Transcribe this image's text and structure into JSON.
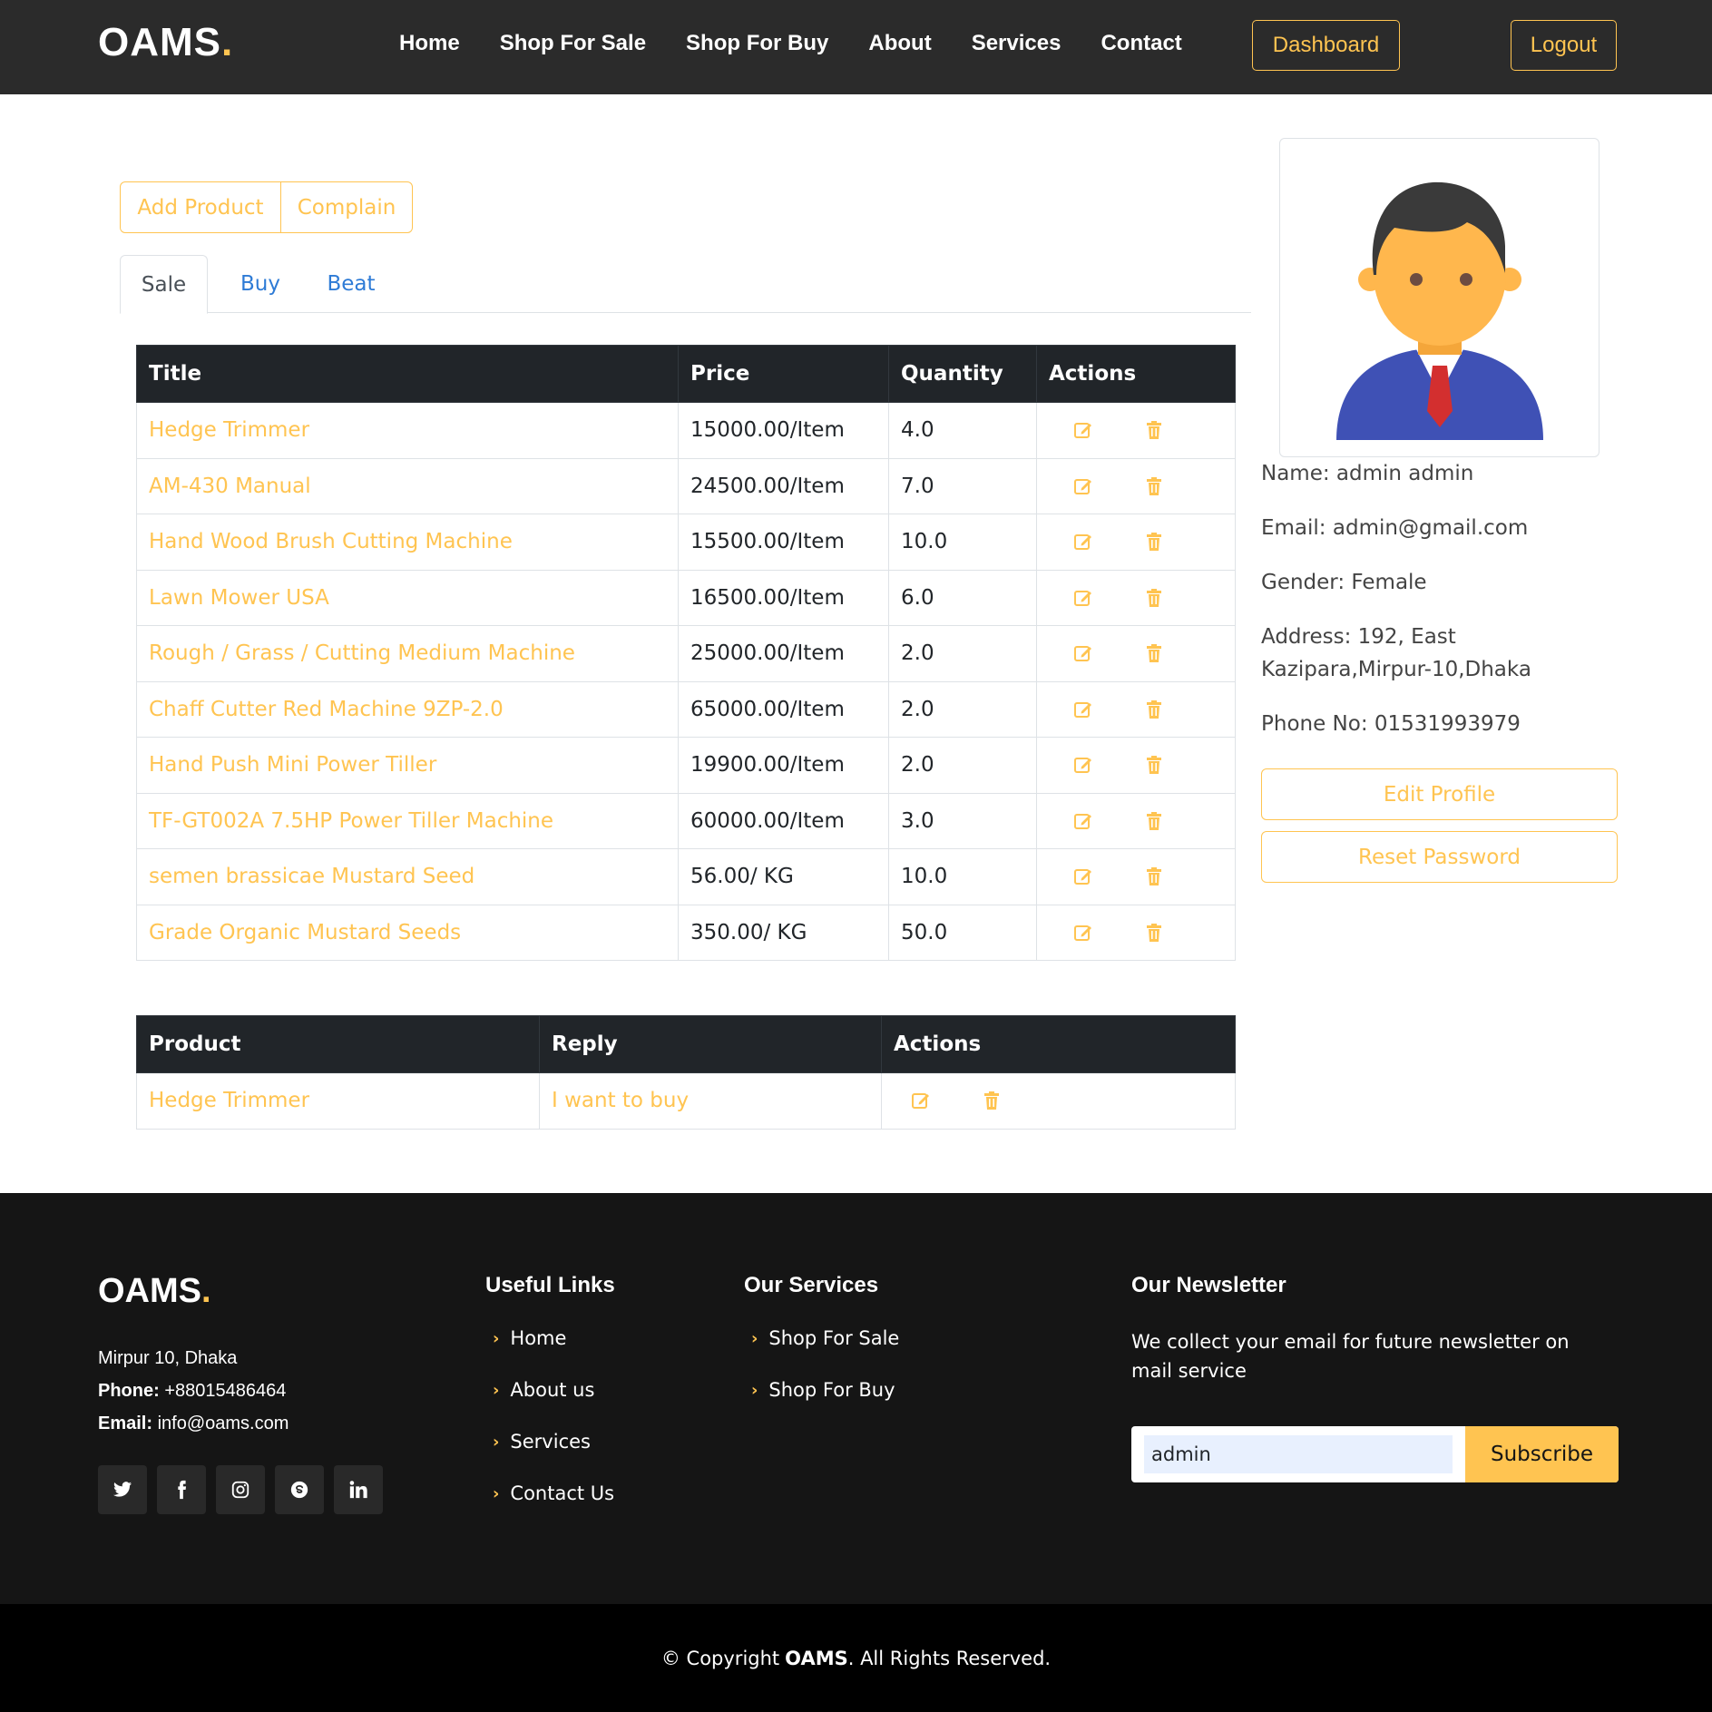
{
  "header": {
    "logo": "OAMS",
    "logo_dot": ".",
    "nav": [
      "Home",
      "Shop For Sale",
      "Shop For Buy",
      "About",
      "Services",
      "Contact"
    ],
    "dashboard_label": "Dashboard",
    "logout_label": "Logout"
  },
  "actions": {
    "add_product": "Add Product",
    "complain": "Complain"
  },
  "tabs": [
    "Sale",
    "Buy",
    "Beat"
  ],
  "active_tab": "Sale",
  "products_table": {
    "headers": [
      "Title",
      "Price",
      "Quantity",
      "Actions"
    ],
    "rows": [
      {
        "title": "Hedge Trimmer",
        "price": "15000.00/Item",
        "quantity": "4.0"
      },
      {
        "title": "AM-430 Manual",
        "price": "24500.00/Item",
        "quantity": "7.0"
      },
      {
        "title": "Hand Wood Brush Cutting Machine",
        "price": "15500.00/Item",
        "quantity": "10.0"
      },
      {
        "title": "Lawn Mower USA",
        "price": "16500.00/Item",
        "quantity": "6.0"
      },
      {
        "title": "Rough / Grass / Cutting Medium Machine",
        "price": "25000.00/Item",
        "quantity": "2.0"
      },
      {
        "title": "Chaff Cutter Red Machine 9ZP-2.0",
        "price": "65000.00/Item",
        "quantity": "2.0"
      },
      {
        "title": "Hand Push Mini Power Tiller",
        "price": "19900.00/Item",
        "quantity": "2.0"
      },
      {
        "title": "TF-GT002A 7.5HP Power Tiller Machine",
        "price": "60000.00/Item",
        "quantity": "3.0"
      },
      {
        "title": "semen brassicae Mustard Seed",
        "price": "56.00/ KG",
        "quantity": "10.0"
      },
      {
        "title": "Grade Organic Mustard Seeds",
        "price": "350.00/ KG",
        "quantity": "50.0"
      }
    ]
  },
  "replies_table": {
    "headers": [
      "Product",
      "Reply",
      "Actions"
    ],
    "rows": [
      {
        "product": "Hedge Trimmer",
        "reply": "I want to buy"
      }
    ]
  },
  "profile": {
    "name": "Name: admin admin",
    "email": "Email: admin@gmail.com",
    "gender": "Gender: Female",
    "address_line1": "Address: 192, East",
    "address_line2": "Kazipara,Mirpur-10,Dhaka",
    "phone": "Phone No: 01531993979",
    "edit_profile": "Edit Profile",
    "reset_password": "Reset Password"
  },
  "footer": {
    "logo": "OAMS",
    "logo_dot": ".",
    "address": "Mirpur 10, Dhaka",
    "phone_label": "Phone:",
    "phone": "+88015486464",
    "email_label": "Email:",
    "email": "info@oams.com",
    "social_icons": [
      "twitter-icon",
      "facebook-icon",
      "instagram-icon",
      "skype-icon",
      "linkedin-icon"
    ],
    "useful_links_title": "Useful Links",
    "useful_links": [
      "Home",
      "About us",
      "Services",
      "Contact Us"
    ],
    "services_title": "Our Services",
    "services": [
      "Shop For Sale",
      "Shop For Buy"
    ],
    "newsletter_title": "Our Newsletter",
    "newsletter_text": "We collect your email for future newsletter on mail service",
    "newsletter_value": "admin",
    "subscribe": "Subscribe",
    "copyright_pre": "© Copyright",
    "copyright_brand": "OAMS",
    "copyright_post": ". All Rights Reserved."
  },
  "colors": {
    "accent": "#ffc451",
    "header_bg": "#2b2b2b",
    "table_head_bg": "#212529",
    "footer_bg": "#151515",
    "link_blue": "#2e7bd6"
  }
}
